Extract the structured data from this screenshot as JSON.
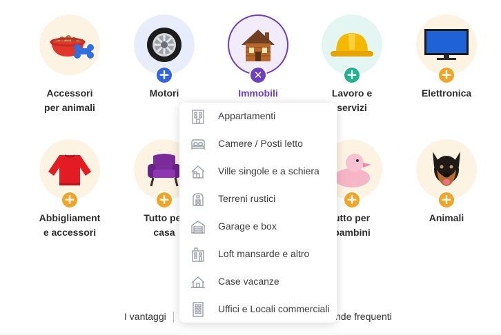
{
  "categories": [
    {
      "name": "Accessori per animali",
      "line1": "Accessori",
      "line2": "per animali",
      "icon": "pet-bowl-icon",
      "state": "collapsed"
    },
    {
      "name": "Motori",
      "line1": "Motori",
      "line2": "",
      "icon": "wheel-icon",
      "state": "collapsed"
    },
    {
      "name": "Immobili",
      "line1": "Immobili",
      "line2": "",
      "icon": "house-icon",
      "state": "expanded"
    },
    {
      "name": "Lavoro e servizi",
      "line1": "Lavoro e",
      "line2": "servizi",
      "icon": "hard-hat-icon",
      "state": "collapsed"
    },
    {
      "name": "Elettronica",
      "line1": "Elettronica",
      "line2": "",
      "icon": "tv-icon",
      "state": "collapsed"
    },
    {
      "name": "Abbigliamento e accessori",
      "line1": "Abbigliament",
      "line2": "e accessori",
      "icon": "sweater-icon",
      "state": "collapsed"
    },
    {
      "name": "Tutto per la casa",
      "line1": "Tutto per",
      "line2": "casa",
      "icon": "armchair-icon",
      "state": "collapsed"
    },
    {
      "name": "Tutto per i bambini",
      "line1": "utto per",
      "line2": "bambini",
      "icon": "rubber-duck-icon",
      "state": "collapsed"
    },
    {
      "name": "Animali",
      "line1": "Animali",
      "line2": "",
      "icon": "dog-icon",
      "state": "collapsed"
    }
  ],
  "dropdown": {
    "items": [
      {
        "label": "Appartamenti",
        "icon": "apartment-building-icon"
      },
      {
        "label": "Camere / Posti letto",
        "icon": "bed-icon"
      },
      {
        "label": "Ville singole e a schiera",
        "icon": "villa-icon"
      },
      {
        "label": "Terreni rustici",
        "icon": "rustic-land-icon"
      },
      {
        "label": "Garage e box",
        "icon": "garage-icon"
      },
      {
        "label": "Loft mansarde e altro",
        "icon": "loft-icon"
      },
      {
        "label": "Case vacanze",
        "icon": "holiday-house-icon"
      },
      {
        "label": "Uffici e Locali commerciali",
        "icon": "office-building-icon"
      }
    ]
  },
  "footer": {
    "advantages": "I vantaggi",
    "faq": "nde frequenti"
  },
  "colors": {
    "accent_purple": "#6d3fc1",
    "badge_blue": "#2f63e8",
    "badge_green": "#21b28e",
    "badge_orange": "#f3a425",
    "circle_cream": "#fdf3e2",
    "circle_blue": "#e8edfb",
    "circle_mint": "#e3f6f1",
    "icon_gray": "#9aa0a8"
  }
}
